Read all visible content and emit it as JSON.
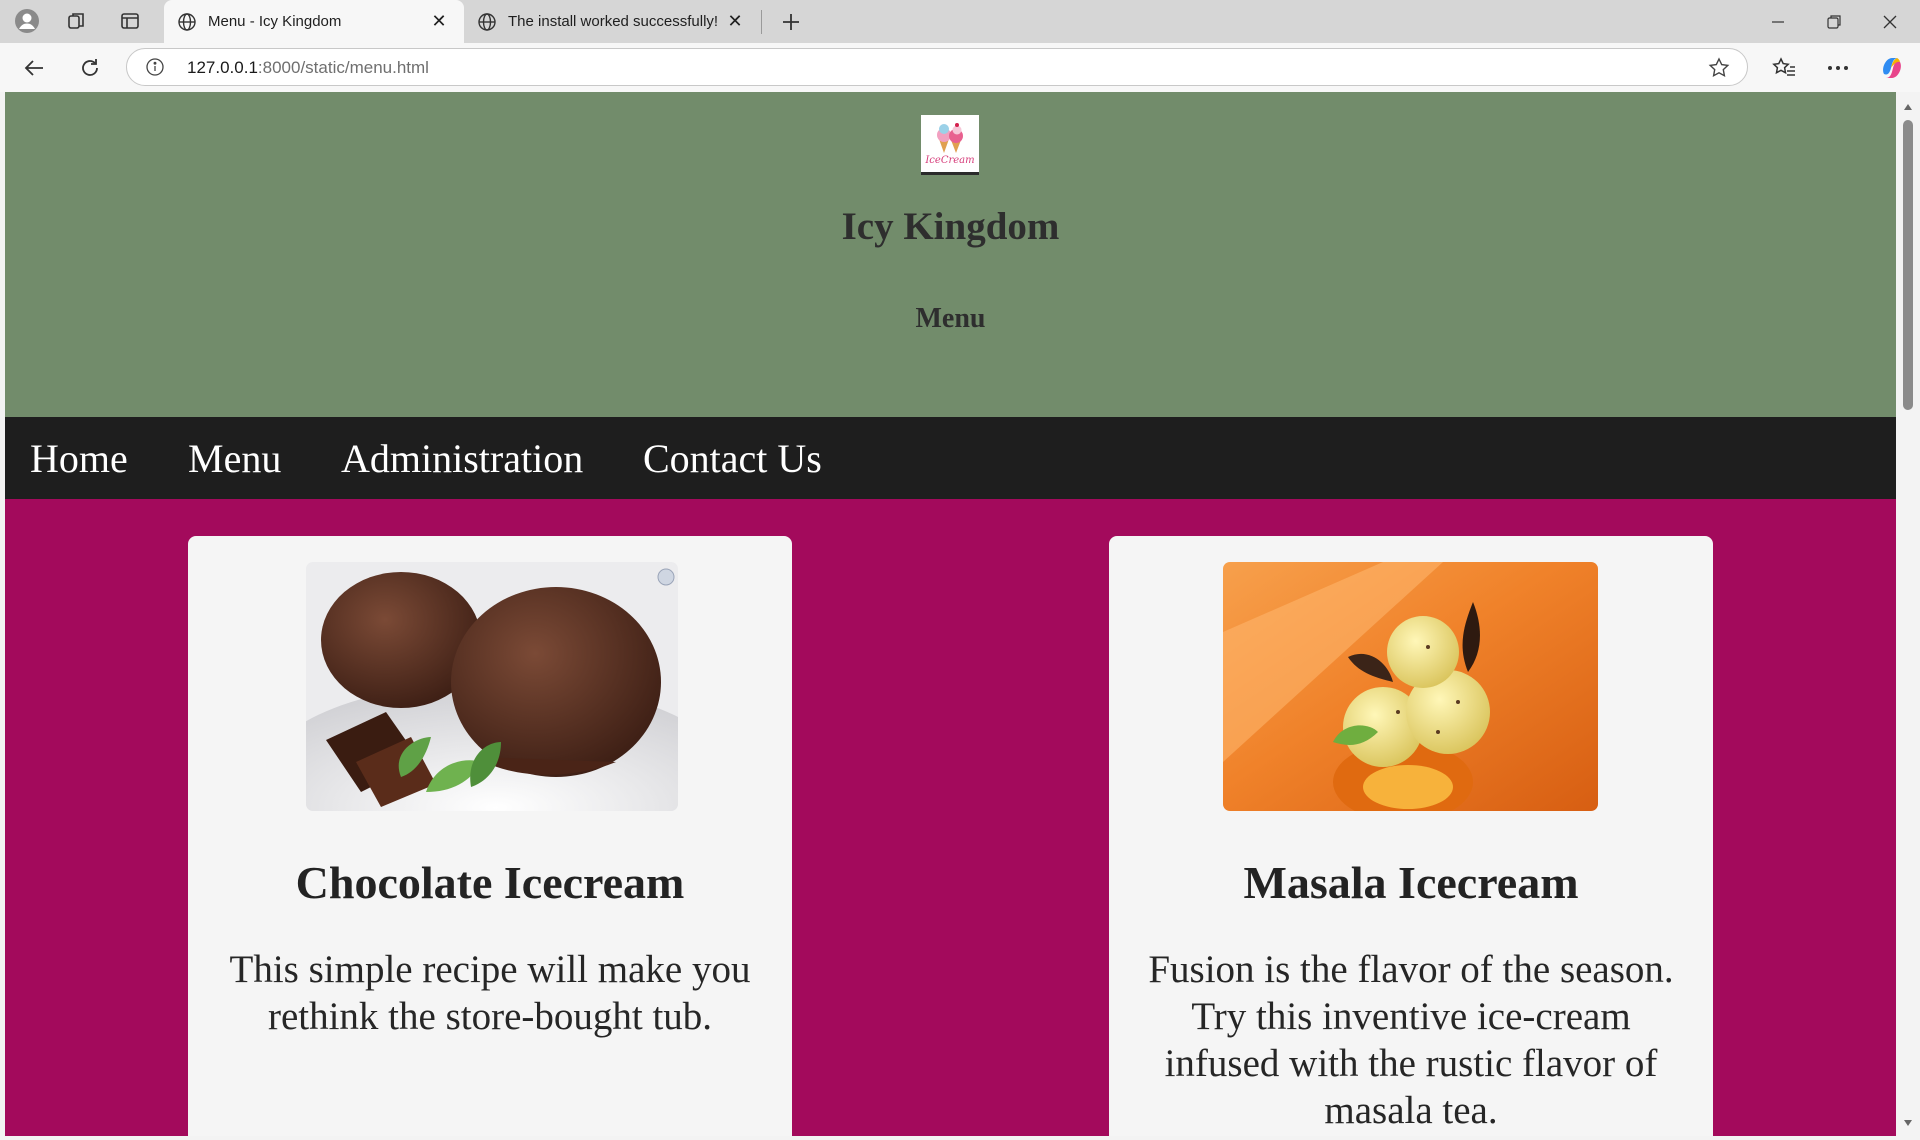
{
  "browser": {
    "tabs": [
      {
        "title": "Menu - Icy Kingdom",
        "active": true
      },
      {
        "title": "The install worked successfully! Co",
        "active": false
      }
    ],
    "url": {
      "host": "127.0.0.1",
      "rest": ":8000/static/menu.html"
    }
  },
  "site": {
    "logo_text": "IceCream",
    "title": "Icy Kingdom",
    "subtitle": "Menu",
    "nav": [
      "Home",
      "Menu",
      "Administration",
      "Contact Us"
    ]
  },
  "cards": [
    {
      "title": "Chocolate Icecream",
      "description": "This simple recipe will make you rethink the store-bought tub."
    },
    {
      "title": "Masala Icecream",
      "description": "Fusion is the flavor of the season. Try this inventive ice-cream infused with the rustic flavor of masala tea."
    }
  ],
  "colors": {
    "header_bg": "#728c6b",
    "nav_bg": "#1e1e1e",
    "page_bg": "#a30a5c",
    "card_bg": "#f5f5f5"
  }
}
